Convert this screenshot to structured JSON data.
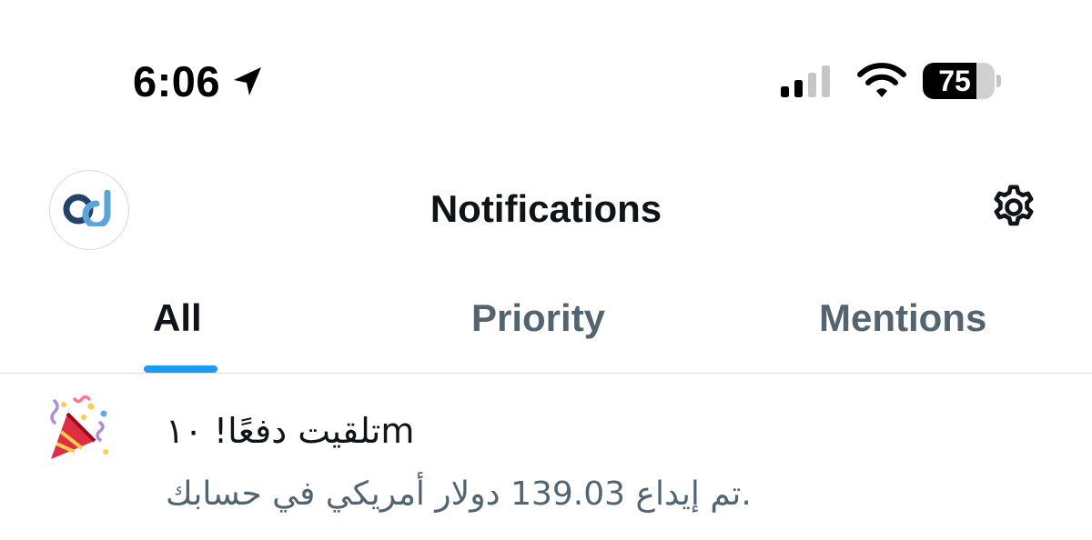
{
  "status_bar": {
    "time": "6:06",
    "battery_level": 75,
    "battery_label": "75",
    "icons": {
      "location": "location-arrow-icon",
      "signal": "cellular-signal-icon",
      "wifi": "wifi-icon",
      "battery": "battery-icon"
    }
  },
  "header": {
    "title": "Notifications",
    "avatar_icon": "profile-logo-icon",
    "settings_icon": "gear-icon"
  },
  "tabs": [
    {
      "label": "All",
      "active": true
    },
    {
      "label": "Priority",
      "active": false
    },
    {
      "label": "Mentions",
      "active": false
    }
  ],
  "notifications": [
    {
      "icon": "party-popper-icon",
      "title": "تلقيت دفعًا! ١٠m",
      "body": "تم إيداع 139.03 دولار أمريكي في حسابك."
    }
  ],
  "colors": {
    "accent": "#1d9bf0",
    "text_primary": "#0f1419",
    "text_secondary": "#536471",
    "divider": "#dcdfe3"
  }
}
